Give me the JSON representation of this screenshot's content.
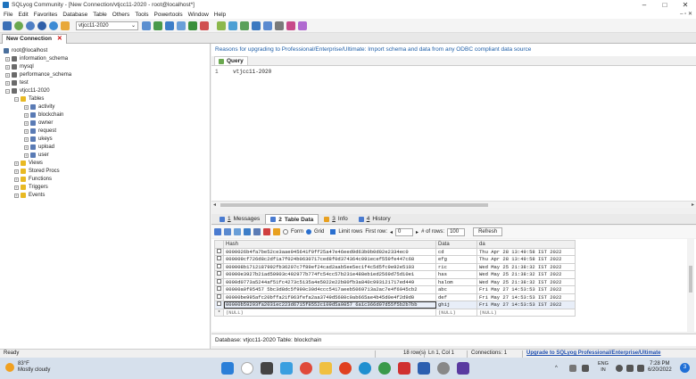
{
  "window": {
    "title": "SQLyog Community - [New Connection/vtjcc11-2020 - root@localhost*]",
    "minimize": "–",
    "maximize": "□",
    "close": "✕"
  },
  "menu": [
    "File",
    "Edit",
    "Favorites",
    "Database",
    "Table",
    "Others",
    "Tools",
    "Powertools",
    "Window",
    "Help"
  ],
  "mdi_controls": "– ▫ ✕",
  "toolbar": {
    "database_selector": "vtjcc11-2020"
  },
  "connection_tab": {
    "label": "New Connection",
    "close": "✕"
  },
  "object_browser": {
    "root": "root@localhost",
    "databases": [
      "information_schema",
      "mysql",
      "performance_schema",
      "test",
      "vtjcc11-2020"
    ],
    "folders": {
      "tables": "Tables",
      "views": "Views",
      "procs": "Stored Procs",
      "functions": "Functions",
      "triggers": "Triggers",
      "events": "Events"
    },
    "tables": [
      "activity",
      "blockchain",
      "owner",
      "request",
      "ukeys",
      "upload",
      "user"
    ]
  },
  "upgrade_banner": "Reasons for upgrading to Professional/Enterprise/Ultimate: Import schema and data from any ODBC compliant data source",
  "query": {
    "tab_label": "Query",
    "line_number": "1",
    "text": "vtjcc11-2020"
  },
  "result_tabs": [
    {
      "number": "1",
      "label": "Messages",
      "color": "#4a7bd0"
    },
    {
      "number": "2",
      "label": "Table Data",
      "color": "#4a7bd0"
    },
    {
      "number": "3",
      "label": "Info",
      "color": "#e8a020"
    },
    {
      "number": "4",
      "label": "History",
      "color": "#4a7bd0"
    }
  ],
  "result_toolbar": {
    "form": "Form",
    "grid": "Grid",
    "limit_rows": "Limit rows",
    "first_row_label": "First row:",
    "first_row_prev": "◂",
    "first_row_value": "0",
    "first_row_next": "▸",
    "num_rows_label": "# of rows:",
    "num_rows_value": "100",
    "refresh": "Refresh"
  },
  "grid": {
    "columns": [
      "Hash",
      "Data",
      "da"
    ],
    "rows": [
      [
        "0000026b4fa7be52ce3aae945641f0ff25a47e46eed9d63b0b0d02e2334ec0",
        "cd",
        "Thu Apr 28 13:49:58 IST 2022"
      ],
      [
        "000009cf726d8c2df1a7f024b0630717ced8f0d374364c091ecef559fe447c68",
        "efg",
        "Thu Apr 28 13:49:58 IST 2022"
      ],
      [
        "000008b1712187992fb36207c7f89ef24cad2aab5ee5ec1f4c5d5fc9e92e5103",
        "ric",
        "Wed May 25 21:38:32 IST 2022"
      ],
      [
        "00000e3927b21ad50903c492977b774fc54cc57b231e488eb1ed2569d75d10e1",
        "has",
        "Wed May 25 21:38:32 IST 2022"
      ],
      [
        "0000d0773a5244af51fc4273c5135a4e5022e22b80fb3a840c993121717ed449",
        "halom",
        "Wed May 25 21:38:32 IST 2022"
      ],
      [
        "00000a0f95457 5bc3d8dc5f990c30d4ccc5417aeeb5069713a2ac7e4f6945cb2",
        "abc",
        "Fri May 27 14:53:53 IST 2022"
      ],
      [
        "00000be995afc20bffa21f063fefa2aa3749d5680c0ab665ae4b45d0e4f2d9d0",
        "def",
        "Fri May 27 14:53:53 IST 2022"
      ],
      [
        "00000b59293fa2031ec223d6715f8552c109d5a9857 6a1c366d07d55f5b2b7bb",
        "ghij",
        "Fri May 27 14:53:53 IST 2022"
      ]
    ],
    "null_row_marker": "*",
    "null": "(NULL)"
  },
  "db_line": "Database: vtjcc11-2020  Table: blockchain",
  "status": {
    "left": "Ready",
    "rows": "18 row(s)",
    "position": "Ln 1, Col 1",
    "connections": "Connections: 1",
    "upgrade": "Upgrade to SQLyog Professional/Enterprise/Ultimate"
  },
  "taskbar": {
    "temp": "83°F",
    "weather": "Mostly cloudy",
    "lang1": "ENG",
    "lang2": "IN",
    "time": "7:28 PM",
    "date": "6/20/2022",
    "notif": "3",
    "tray_chevron": "^"
  }
}
